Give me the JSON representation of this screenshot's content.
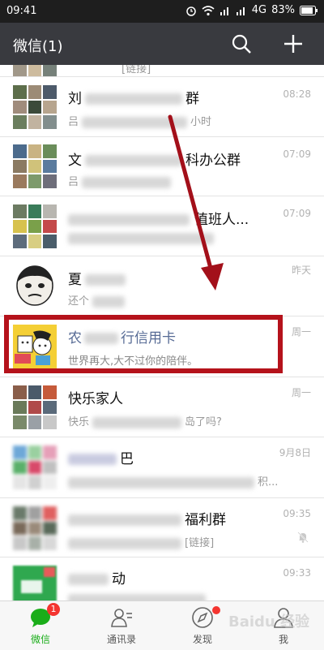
{
  "status": {
    "time": "09:41",
    "network": "4G",
    "battery": "83%"
  },
  "header": {
    "title": "微信(1)",
    "search_icon": "search-icon",
    "add_icon": "plus-icon"
  },
  "chats": [
    {
      "name": "",
      "preview": "[链接]",
      "time": ""
    },
    {
      "name_start": "刘",
      "name_end": "群",
      "preview_start": "吕",
      "preview_end": "小时",
      "time": "08:28"
    },
    {
      "name_start": "文",
      "name_end": "科办公群",
      "preview_start": "吕",
      "time": "07:09"
    },
    {
      "name_end": "值班人...",
      "time": "07:09"
    },
    {
      "name_start": "夏",
      "preview_start": "还个",
      "time": "昨天"
    },
    {
      "name_start": "农",
      "name_end": "行信用卡",
      "preview": "世界再大,大不过你的陪伴。",
      "time": "周一"
    },
    {
      "name": "快乐家人",
      "preview_start": "快乐",
      "preview_end": "岛了吗?",
      "time": "周一"
    },
    {
      "name_end": "巴",
      "preview_end": "积...",
      "time": "9月8日"
    },
    {
      "name_end": "福利群",
      "preview_end": "[链接]",
      "time": "09:35"
    },
    {
      "name_end": "动",
      "time": "09:33"
    }
  ],
  "tabs": [
    {
      "label": "微信",
      "badge": "1",
      "icon": "chat-bubble-icon"
    },
    {
      "label": "通讯录",
      "icon": "contacts-icon"
    },
    {
      "label": "发现",
      "icon": "compass-icon"
    },
    {
      "label": "我",
      "icon": "person-icon"
    }
  ],
  "watermark": "Baidu 经验",
  "colors": {
    "accent": "#1aad19",
    "header": "#393a3f",
    "highlight": "#b5121b",
    "badge": "#f43530"
  }
}
